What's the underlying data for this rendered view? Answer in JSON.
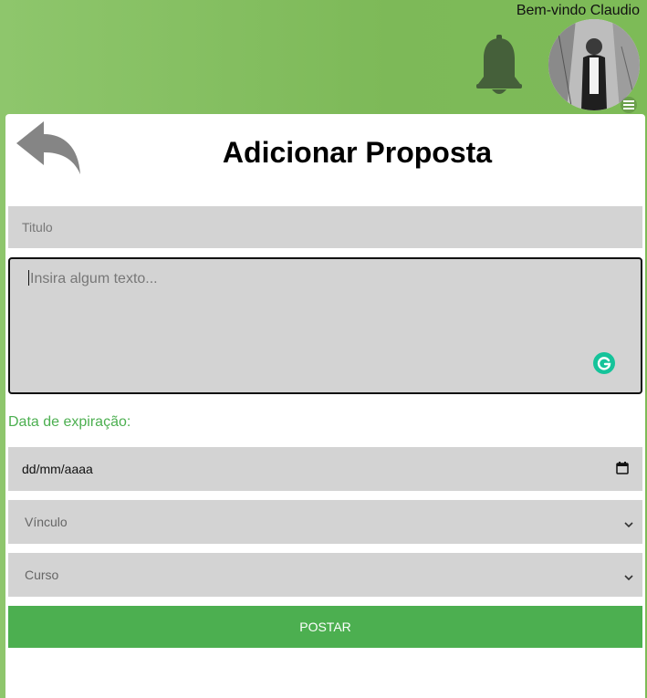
{
  "header": {
    "welcome_text": "Bem-vindo Claudio",
    "bell_icon": "bell-icon",
    "avatar_alt": "profile photo",
    "menu_icon": "hamburger-icon"
  },
  "form": {
    "page_title": "Adicionar Proposta",
    "back_icon": "back-arrow-icon",
    "title_placeholder": "Titulo",
    "text_placeholder": "Insira algum texto...",
    "expiry_label": "Data de expiração:",
    "date_value": "dd/mm/aaaa",
    "vinculo_value": "Vínculo",
    "curso_value": "Curso",
    "post_button": "POSTAR"
  },
  "colors": {
    "accent_green": "#4caf50",
    "header_green": "#7db958",
    "field_gray": "#d3d3d3"
  }
}
